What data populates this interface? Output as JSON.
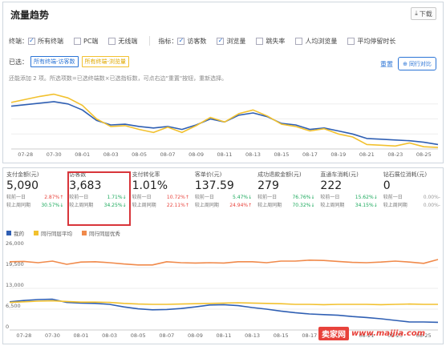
{
  "top": {
    "title": "流量趋势",
    "download_label": "下载",
    "terminal_label": "终端：",
    "terminals": [
      {
        "label": "所有终端",
        "checked": true
      },
      {
        "label": "PC端",
        "checked": false
      },
      {
        "label": "无线端",
        "checked": false
      }
    ],
    "metric_label": "指标：",
    "metric_options": [
      {
        "label": "访客数",
        "checked": true
      },
      {
        "label": "浏览量",
        "checked": true
      },
      {
        "label": "跳失率",
        "checked": false
      },
      {
        "label": "人均浏览量",
        "checked": false
      },
      {
        "label": "平均停留时长",
        "checked": false
      }
    ],
    "selected_label": "已选：",
    "selected_tags": [
      "所有终端-访客数",
      "所有终端-浏览量"
    ],
    "hint": "还能添加 2 项。所选项数=已选终端数×已选指标数，可点右边\"重置\"按钮，重新选择。",
    "reset_label": "重置",
    "compare_label": "同行对比",
    "x_labels": [
      "07-28",
      "07-30",
      "08-01",
      "08-03",
      "08-05",
      "08-07",
      "08-09",
      "08-11",
      "08-13",
      "08-15",
      "08-17",
      "08-19",
      "08-21",
      "08-23",
      "08-25"
    ]
  },
  "metrics": [
    {
      "label": "支付金额(元)",
      "value": "5,090",
      "r1": "较前一日",
      "v1": "2.87%",
      "d1": "up",
      "r2": "较上周同期",
      "v2": "30.57%",
      "d2": "down"
    },
    {
      "label": "访客数",
      "value": "3,683",
      "r1": "较前一日",
      "v1": "1.71%",
      "d1": "down",
      "r2": "较上周同期",
      "v2": "34.25%",
      "d2": "down"
    },
    {
      "label": "支付转化率",
      "value": "1.01%",
      "r1": "较前一日",
      "v1": "10.72%",
      "d1": "up",
      "r2": "较上周同期",
      "v2": "22.11%",
      "d2": "up"
    },
    {
      "label": "客单价(元)",
      "value": "137.59",
      "r1": "较前一日",
      "v1": "5.47%",
      "d1": "down",
      "r2": "较上周同期",
      "v2": "24.94%",
      "d2": "up"
    },
    {
      "label": "成功退款金额(元)",
      "value": "279",
      "r1": "较前一日",
      "v1": "76.76%",
      "d1": "down",
      "r2": "较上周同期",
      "v2": "70.32%",
      "d2": "down"
    },
    {
      "label": "直通车消耗(元)",
      "value": "222",
      "r1": "较前一日",
      "v1": "15.62%",
      "d1": "down",
      "r2": "较上周同期",
      "v2": "34.15%",
      "d2": "down"
    },
    {
      "label": "钻石展位消耗(元)",
      "value": "0",
      "r1": "较前一日",
      "v1": "0.00%",
      "d1": "none",
      "r2": "较上周同期",
      "v2": "0.00%",
      "d2": "none"
    }
  ],
  "bottom": {
    "legend": [
      {
        "label": "我的",
        "color": "#2f5fb3"
      },
      {
        "label": "同行同层平均",
        "color": "#f2c12e"
      },
      {
        "label": "同行同层优秀",
        "color": "#f08a4b"
      }
    ],
    "y_labels": [
      "26,000",
      "19,500",
      "13,000",
      "6,500",
      "0"
    ],
    "x_labels": [
      "07-28",
      "07-30",
      "08-01",
      "08-03",
      "08-05",
      "08-07",
      "08-09",
      "08-11",
      "08-13",
      "08-15",
      "08-17",
      "08-19",
      "08-21",
      "08-23",
      "08-25"
    ]
  },
  "colors": {
    "accent": "#2b74d6",
    "visitors": "#2f5fb3",
    "pageviews": "#f2c12e",
    "excellent": "#f08a4b",
    "up": "#e8423b",
    "down": "#18a85a"
  },
  "chart_data": [
    {
      "type": "line",
      "title": "",
      "x": [
        "07-27",
        "07-28",
        "07-29",
        "07-30",
        "07-31",
        "08-01",
        "08-02",
        "08-03",
        "08-04",
        "08-05",
        "08-06",
        "08-07",
        "08-08",
        "08-09",
        "08-10",
        "08-11",
        "08-12",
        "08-13",
        "08-14",
        "08-15",
        "08-16",
        "08-17",
        "08-18",
        "08-19",
        "08-20",
        "08-21",
        "08-22",
        "08-23",
        "08-24",
        "08-25",
        "08-26"
      ],
      "series": [
        {
          "name": "访客数",
          "values": [
            57,
            59,
            61,
            63,
            60,
            52,
            38,
            32,
            33,
            30,
            28,
            30,
            26,
            32,
            40,
            36,
            45,
            48,
            43,
            34,
            32,
            26,
            28,
            24,
            20,
            14,
            13,
            12,
            11,
            9,
            6
          ]
        },
        {
          "name": "浏览量",
          "values": [
            62,
            66,
            70,
            73,
            68,
            58,
            40,
            30,
            31,
            26,
            22,
            29,
            22,
            31,
            42,
            36,
            47,
            52,
            44,
            33,
            30,
            24,
            27,
            20,
            16,
            6,
            5,
            4,
            8,
            3,
            2
          ]
        }
      ]
    },
    {
      "type": "line",
      "title": "",
      "x": [
        "07-27",
        "07-28",
        "07-29",
        "07-30",
        "07-31",
        "08-01",
        "08-02",
        "08-03",
        "08-04",
        "08-05",
        "08-06",
        "08-07",
        "08-08",
        "08-09",
        "08-10",
        "08-11",
        "08-12",
        "08-13",
        "08-14",
        "08-15",
        "08-16",
        "08-17",
        "08-18",
        "08-19",
        "08-20",
        "08-21",
        "08-22",
        "08-23",
        "08-24",
        "08-25",
        "08-26"
      ],
      "ylim": [
        0,
        26000
      ],
      "series": [
        {
          "name": "我的",
          "values": [
            8800,
            9200,
            9500,
            9600,
            8600,
            8400,
            8300,
            8000,
            7200,
            6600,
            6300,
            6400,
            6700,
            7200,
            7800,
            7900,
            7600,
            7000,
            6500,
            5900,
            5400,
            5000,
            4800,
            4600,
            4200,
            3900,
            3500,
            3000,
            2500,
            2500,
            2400
          ]
        },
        {
          "name": "同行同层平均",
          "values": [
            8600,
            8800,
            9000,
            9100,
            8900,
            8700,
            8700,
            8600,
            8300,
            8100,
            8000,
            8000,
            8100,
            8200,
            8300,
            8400,
            8500,
            8400,
            8300,
            8200,
            8000,
            8000,
            7900,
            8000,
            8000,
            8000,
            7900,
            8000,
            8100,
            8000,
            8000
          ]
        },
        {
          "name": "同行同层优秀",
          "values": [
            21300,
            21400,
            21000,
            21500,
            20500,
            21200,
            21300,
            21000,
            20600,
            20300,
            20300,
            21300,
            21000,
            20900,
            21000,
            20900,
            21300,
            21300,
            21000,
            21500,
            21500,
            21800,
            21700,
            21400,
            21100,
            21000,
            21200,
            21500,
            21200,
            20800,
            22000
          ]
        }
      ]
    }
  ]
}
